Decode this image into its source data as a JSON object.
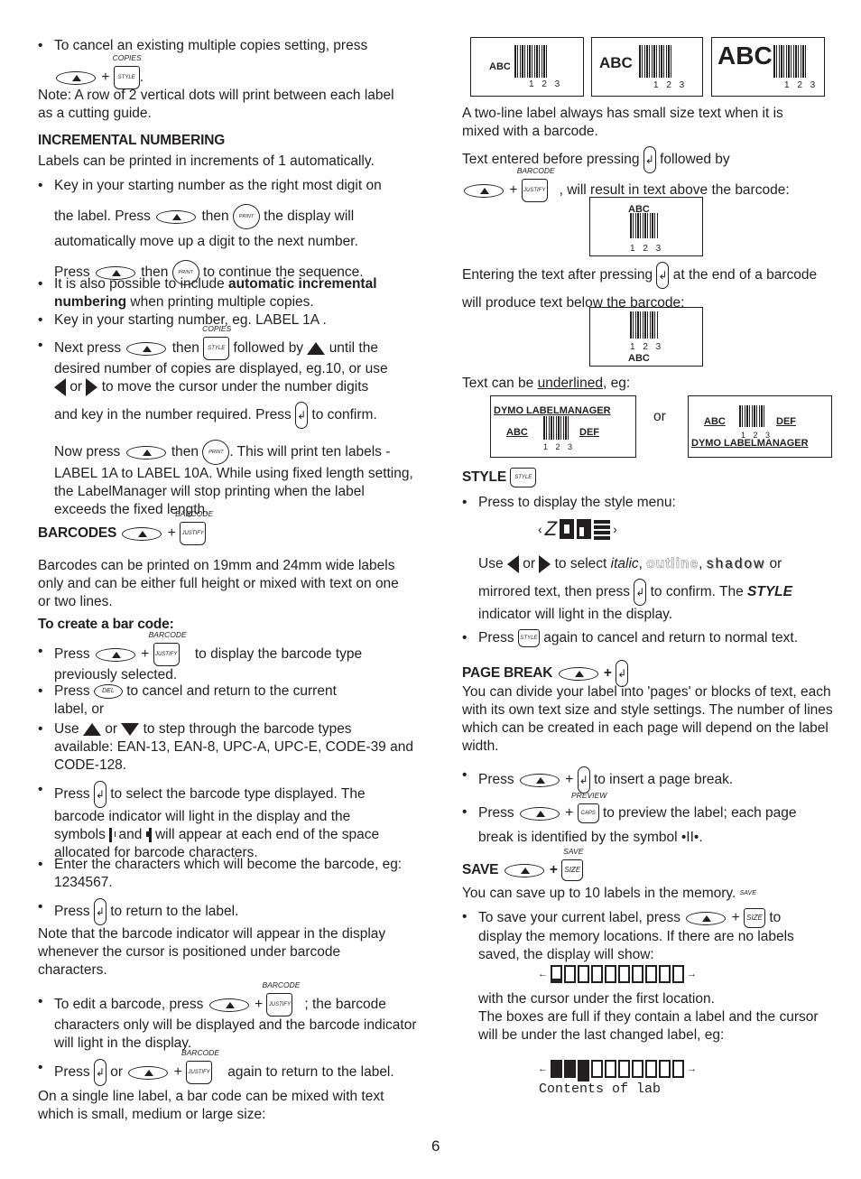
{
  "left": {
    "cancel_copies": "To cancel an existing multiple copies setting, press",
    "note_dots": "Note:  A row of 2 vertical dots will print between each label as a cutting guide.",
    "incr_heading": "INCREMENTAL NUMBERING",
    "incr_intro": "Labels can be printed in increments of 1 automatically.",
    "incr_b1_line1": "Key in your starting number as the right most digit on",
    "incr_b1_line2a": "the label. Press",
    "incr_b1_line2b": "then",
    "incr_b1_line2c": "the display will",
    "incr_b1_line3": "automatically move up a digit to the next number.",
    "incr_b1_line4a": "Press",
    "incr_b1_line4b": "then",
    "incr_b1_line4c": "to continue the sequence.",
    "incr_b2_pre": "It is also possible to include ",
    "incr_b2_bold1": "automatic incremental",
    "incr_b2_bold2": "numbering",
    "incr_b2_post": " when printing multiple copies.",
    "incr_b3": "Key in your starting number, eg. LABEL 1A .",
    "incr_b4_a": "Next press",
    "incr_b4_b": "then",
    "incr_b4_c": "followed by",
    "incr_b4_d": "until the",
    "incr_b4_line2": "desired number of copies are displayed, eg.10, or use",
    "incr_b4_line3a": "or",
    "incr_b4_line3b": "to move the cursor under the number digits",
    "incr_b4_line4a": "and key in the number required. Press",
    "incr_b4_line4b": "to confirm.",
    "incr_b4_line5a": "Now press",
    "incr_b4_line5b": "then",
    "incr_b4_line5c": ". This will print ten labels -",
    "incr_b4_line6": "LABEL 1A to LABEL 10A. While using fixed length setting, the LabelManager will stop printing when the label exceeds the fixed length.",
    "bc_heading": "BARCODES",
    "bc_intro": "Barcodes can be printed on 19mm and 24mm wide labels only and can be either full height or mixed with text on one or two lines.",
    "bc_create": "To create a bar code:",
    "bc_b1a": "Press",
    "bc_b1b": "to display the barcode type",
    "bc_b1c": "previously selected.",
    "bc_b2a": "Press",
    "bc_b2b": "to cancel and return to the current",
    "bc_b2c": "label, or",
    "bc_b3a": "Use",
    "bc_b3b": "or",
    "bc_b3c": "to step through the barcode types",
    "bc_b3d": "available: EAN-13, EAN-8, UPC-A, UPC-E, CODE-39 and CODE-128.",
    "bc_b4a": "Press",
    "bc_b4b": "to select the barcode type displayed. The",
    "bc_b4c": "barcode indicator will light in the display and the",
    "bc_b4d": "symbols",
    "bc_b4e": "and",
    "bc_b4f": "will appear at each end of the  space",
    "bc_b4g": "allocated for barcode characters.",
    "bc_b5": "Enter the characters which will become the barcode, eg: 1234567.",
    "bc_b6a": "Press",
    "bc_b6b": "to return to the label.",
    "bc_note": "Note that the barcode indicator will appear in the display whenever the cursor is positioned under barcode characters.",
    "bc_edit_a": "To edit a barcode, press",
    "bc_edit_b": "; the barcode",
    "bc_edit_c": "characters only will be displayed and the barcode indicator will light in the display.",
    "bc_ret_a": "Press",
    "bc_ret_b": "or",
    "bc_ret_c": "again to return to the label.",
    "bc_single": "On a single line label, a bar code can be mixed with text which is small, medium or large size:"
  },
  "keys": {
    "copies": "COPIES",
    "style": "STYLE",
    "print": "PRINT",
    "barcode": "BARCODE",
    "justify": "JUSTIFY",
    "del": "DEL",
    "preview": "PREVIEW",
    "caps": "CAPS",
    "save": "SAVE",
    "size": "SIZE",
    "plus": "+"
  },
  "right": {
    "sample_abc": "ABC",
    "sample_num": "1 2 3",
    "two_line": "A two-line label always has small size text when it is mixed with a barcode.",
    "before_a": "Text entered before pressing",
    "before_b": "followed by",
    "before_c": ", will result in text above the barcode:",
    "after_a": "Entering the text after pressing",
    "after_b": "at the end of a barcode",
    "after_c": "will produce text below the barcode:",
    "underline_a": "Text can be ",
    "underline_b": "underlined",
    "underline_c": ", eg:",
    "dymo": "DYMO LABELMANAGER",
    "def": "DEF",
    "or": "or",
    "style_heading": "STYLE",
    "style_b1": "Press to display the style menu:",
    "style_use_a": "Use",
    "style_use_b": "or",
    "style_use_c": "to select ",
    "style_italic": "italic",
    "style_outline": "outline",
    "style_shadow": "shadow",
    "style_use_d": " or",
    "style_mirror_a": "mirrored text, then press",
    "style_mirror_b": "to confirm. The ",
    "style_mirror_bold": "STYLE",
    "style_mirror_c": "indicator will light in the display.",
    "style_b2a": "Press",
    "style_b2b": "again to cancel and return to normal text.",
    "pb_heading": "PAGE BREAK",
    "pb_intro": "You can divide your label into 'pages' or blocks of text, each with its own text size and style settings. The number of lines which can be created in each page will depend on the label width.",
    "pb_b1a": "Press",
    "pb_b1b": "to insert a page break.",
    "pb_b2a": "Press",
    "pb_b2b": "to preview the label; each page",
    "pb_b2c": "break is identified by the symbol •II•.",
    "save_heading": "SAVE",
    "save_intro": "You can save up to 10 labels in the memory.",
    "save_b1a": "To save your current label, press",
    "save_b1b": "to",
    "save_b1c": "display the memory locations. If there are no labels saved, the display will show:",
    "save_cursor": "with the cursor under the first location.",
    "save_full": "The boxes are full if they contain a label and the cursor will be under the last changed label, eg:",
    "save_contents": "Contents of lab"
  },
  "page_number": "6"
}
